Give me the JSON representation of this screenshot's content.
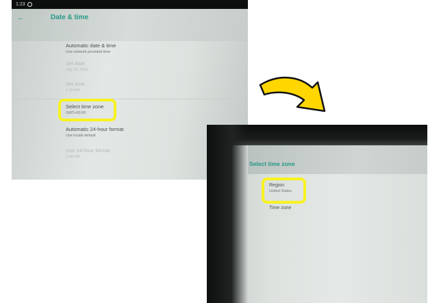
{
  "screen1": {
    "status_time": "1:23",
    "title": "Date & time",
    "back_icon": "back-arrow-icon",
    "items": [
      {
        "title": "Automatic date & time",
        "subtitle": "Use network provided time",
        "enabled": true
      },
      {
        "title": "Set date",
        "subtitle": "July 30, 2021",
        "enabled": false
      },
      {
        "title": "Set time",
        "subtitle": "1:23 AM",
        "enabled": false
      },
      {
        "title": "Select time zone",
        "subtitle": "GMT+00:00",
        "enabled": true,
        "highlighted": true
      },
      {
        "title": "Automatic 24-hour format",
        "subtitle": "Use locale default",
        "enabled": true
      },
      {
        "title": "Use 24-hour format",
        "subtitle": "1:00 PM",
        "enabled": false
      }
    ]
  },
  "screen2": {
    "title": "Select time zone",
    "items": [
      {
        "title": "Region",
        "subtitle": "United States",
        "highlighted": true
      },
      {
        "title": "Time zone",
        "subtitle": ""
      }
    ]
  },
  "colors": {
    "accent": "#239987",
    "highlight": "#f8f21f",
    "arrow_fill": "#ffd600"
  }
}
